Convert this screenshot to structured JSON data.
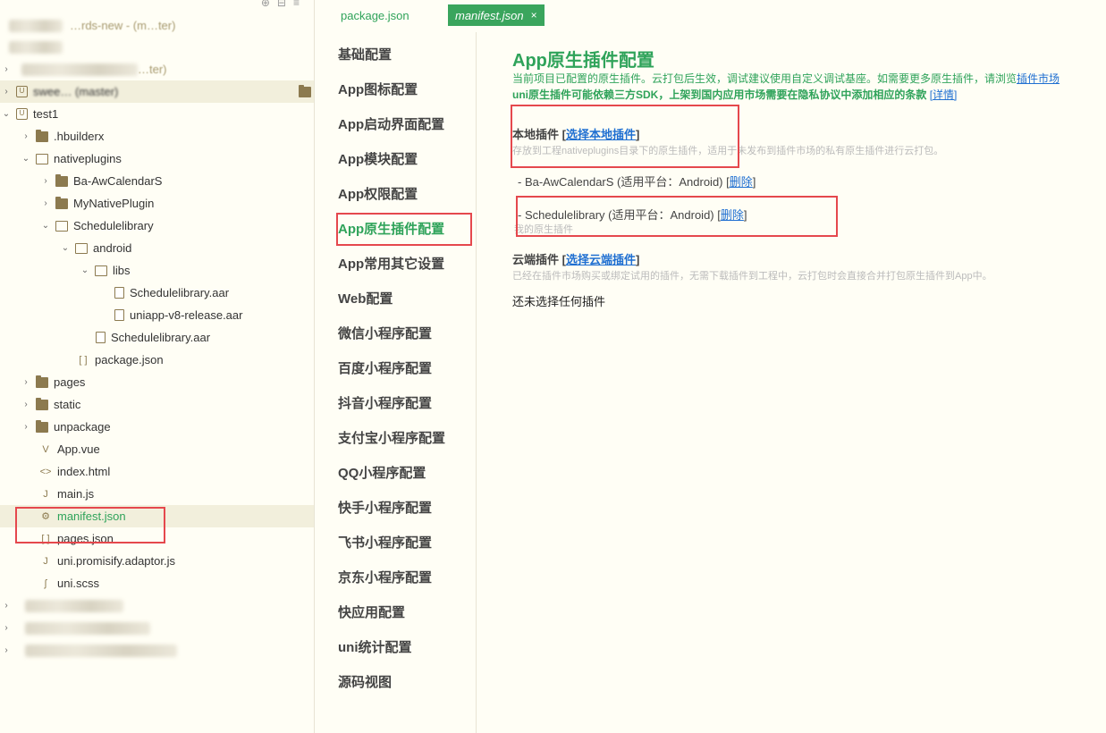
{
  "tree": {
    "header_tools": [
      "⊕",
      "⊟",
      "≡"
    ],
    "rows": [
      {
        "label": "…rds-new - (m…ter)",
        "blurred": true
      },
      {
        "label": "",
        "blurred": true
      },
      {
        "label": "…ter)",
        "blurred": true
      },
      {
        "label": "swee… (master)",
        "blurred": true
      },
      {
        "label": "test1"
      },
      {
        "label": ".hbuilderx"
      },
      {
        "label": "nativeplugins"
      },
      {
        "label": "Ba-AwCalendarS"
      },
      {
        "label": "MyNativePlugin"
      },
      {
        "label": "Schedulelibrary"
      },
      {
        "label": "android"
      },
      {
        "label": "libs"
      },
      {
        "label": "Schedulelibrary.aar"
      },
      {
        "label": "uniapp-v8-release.aar"
      },
      {
        "label": "Schedulelibrary.aar"
      },
      {
        "label": "package.json"
      },
      {
        "label": "pages"
      },
      {
        "label": "static"
      },
      {
        "label": "unpackage"
      },
      {
        "label": "App.vue"
      },
      {
        "label": "index.html"
      },
      {
        "label": "main.js"
      },
      {
        "label": "manifest.json"
      },
      {
        "label": "pages.json"
      },
      {
        "label": "uni.promisify.adaptor.js"
      },
      {
        "label": "uni.scss"
      }
    ]
  },
  "tabs": {
    "inactive": "package.json",
    "active": "manifest.json",
    "close": "×"
  },
  "nav": {
    "items": [
      "基础配置",
      "App图标配置",
      "App启动界面配置",
      "App模块配置",
      "App权限配置",
      "App原生插件配置",
      "App常用其它设置",
      "Web配置",
      "微信小程序配置",
      "百度小程序配置",
      "抖音小程序配置",
      "支付宝小程序配置",
      "QQ小程序配置",
      "快手小程序配置",
      "飞书小程序配置",
      "京东小程序配置",
      "快应用配置",
      "uni统计配置",
      "源码视图"
    ],
    "active_index": 5
  },
  "content": {
    "title": "App原生插件配置",
    "desc1": "当前项目已配置的原生插件。云打包后生效，调试建议使用自定义调试基座。如需要更多原生插件，请浏览",
    "desc1_link": "插件市场",
    "desc2": "uni原生插件可能依赖三方SDK，上架到国内应用市场需要在隐私协议中添加相应的条款",
    "desc2_link": "[详情]",
    "local": {
      "heading": "本地插件",
      "bracket_open": "[",
      "link": "选择本地插件",
      "bracket_close": "]",
      "hint": "存放到工程nativeplugins目录下的原生插件，适用于未发布到插件市场的私有原生插件进行云打包。",
      "plugins": [
        {
          "text": "- Ba-AwCalendarS (适用平台：Android)",
          "action": "删除"
        },
        {
          "text": "- Schedulelibrary (适用平台：Android)",
          "action": "删除",
          "sub": "我的原生插件"
        }
      ]
    },
    "cloud": {
      "heading": "云端插件",
      "bracket_open": "[",
      "link": "选择云端插件",
      "bracket_close": "]",
      "hint": "已经在插件市场购买或绑定试用的插件，无需下载插件到工程中，云打包时会直接合并打包原生插件到App中。",
      "empty": "还未选择任何插件"
    }
  }
}
